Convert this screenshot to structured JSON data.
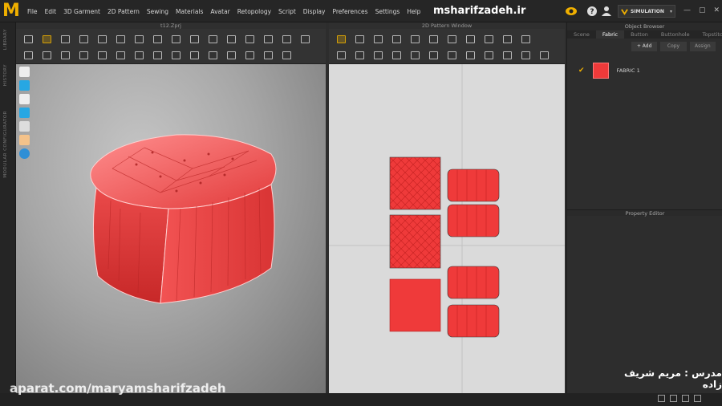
{
  "app": {
    "logo": "M",
    "brand": "msharifzadeh.ir"
  },
  "menu": [
    "File",
    "Edit",
    "3D Garment",
    "2D Pattern",
    "Sewing",
    "Materials",
    "Avatar",
    "Retopology",
    "Script",
    "Display",
    "Preferences",
    "Settings",
    "Help"
  ],
  "topright": {
    "simulation": "SIMULATION",
    "help": "?"
  },
  "left_rail": [
    "LIBRARY",
    "HISTORY",
    "MODULAR CONFIGURATOR"
  ],
  "panel3d": {
    "title": "t12.Zprj"
  },
  "panel2d": {
    "title": "2D Pattern Window"
  },
  "object_browser": {
    "title": "Object Browser",
    "tabs": [
      "Scene",
      "Fabric",
      "Button",
      "Buttonhole",
      "Topstitch"
    ],
    "active_tab": "Fabric",
    "actions": [
      "+ Add",
      "Copy",
      "Assign"
    ],
    "fabrics": [
      {
        "name": "FABRIC 1",
        "color": "#ef3a3a",
        "selected": true
      }
    ]
  },
  "property_editor": {
    "title": "Property Editor"
  },
  "watermark": "aparat.com/maryamsharifzadeh",
  "instructor": "مدرس : مریم شریف زاده",
  "colors": {
    "accent": "#f0b000",
    "fabric": "#ef3a3a"
  }
}
